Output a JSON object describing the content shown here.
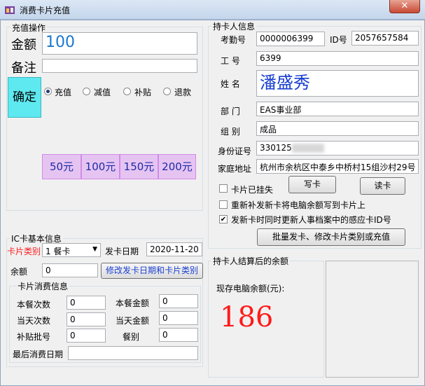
{
  "window": {
    "title": "消费卡片充值",
    "close": "✕"
  },
  "recharge": {
    "group_label": "充值操作",
    "amount_label": "金额",
    "amount_value": "100",
    "note_label": "备注",
    "note_value": "",
    "confirm_label": "确定",
    "modes": [
      {
        "label": "充值",
        "selected": true
      },
      {
        "label": "减值",
        "selected": false
      },
      {
        "label": "补贴",
        "selected": false
      },
      {
        "label": "退款",
        "selected": false
      }
    ],
    "quick_amounts": [
      "50元",
      "100元",
      "150元",
      "200元"
    ]
  },
  "holder": {
    "group_label": "持卡人信息",
    "attendance_label": "考勤号",
    "attendance_value": "0000006399",
    "id_label": "ID号",
    "id_value": "2057657584",
    "empno_label": "工 号",
    "empno_value": "6399",
    "name_label": "姓 名",
    "name_value": "潘盛秀",
    "dept_label": "部 门",
    "dept_value": "EAS事业部",
    "team_label": "组 别",
    "team_value": "成品",
    "idcard_label": "身份证号",
    "idcard_value": "330125",
    "address_label": "家庭地址",
    "address_value": "杭州市余杭区中泰乡中桥村15组沙村29号",
    "lost_label": "卡片已挂失",
    "lost_checked": false,
    "write_button": "写卡",
    "read_button": "读卡",
    "reissue_label": "重新补发新卡将电脑余额写到卡片上",
    "reissue_checked": false,
    "update_label": "发新卡时同时更新人事档案中的感应卡ID号",
    "update_checked": true,
    "batch_button": "批量发卡、修改卡片类别或充值"
  },
  "ic": {
    "group_label": "IC卡基本信息",
    "card_type_label": "卡片类别",
    "card_type_value": "1 餐卡",
    "issue_date_label": "发卡日期",
    "issue_date_value": "2020-11-20",
    "balance_label": "余额",
    "balance_value": "0",
    "modify_button": "修改发卡日期和卡片类别",
    "consume": {
      "group_label": "卡片消费信息",
      "meal_count_label": "本餐次数",
      "meal_count_value": "0",
      "meal_amount_label": "本餐金额",
      "meal_amount_value": "0",
      "day_count_label": "当天次数",
      "day_count_value": "0",
      "day_amount_label": "当天金额",
      "day_amount_value": "0",
      "subsidy_label": "补贴批号",
      "subsidy_value": "0",
      "meal_type_label": "餐别",
      "meal_type_value": "0",
      "last_date_label": "最后消费日期",
      "last_date_value": ""
    }
  },
  "after": {
    "group_label": "持卡人结算后的余额",
    "balance_label": "现存电脑余额(元):",
    "balance_value": "186"
  },
  "colors": {
    "accent_red": "#ff1a1a",
    "blue_text": "#1a3fd1",
    "confirm_bg": "#5ee8ef",
    "amount_bg": "#e6c4f2"
  }
}
